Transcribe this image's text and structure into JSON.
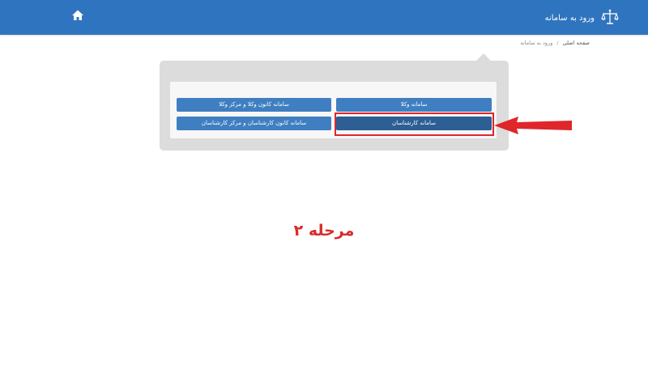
{
  "header": {
    "title": "ورود به سامانه",
    "brand_color": "#2f74bf",
    "logo_icon": "scales-of-justice-icon",
    "home_icon": "home-icon"
  },
  "breadcrumb": {
    "home": "صفحه اصلی",
    "separator": "/",
    "current": "ورود به سامانه"
  },
  "systems": {
    "lawyers": "سامانه وکلا",
    "bar_and_center_lawyers": "سامانه کانون وکلا و مرکز وکلا",
    "experts": "سامانه کارشناسان",
    "council_and_center_experts": "سامانه کانون کارشناسان و مرکز کارشناسان"
  },
  "annotation": {
    "step": "مرحله ۲",
    "highlight_color": "#e0262a"
  }
}
